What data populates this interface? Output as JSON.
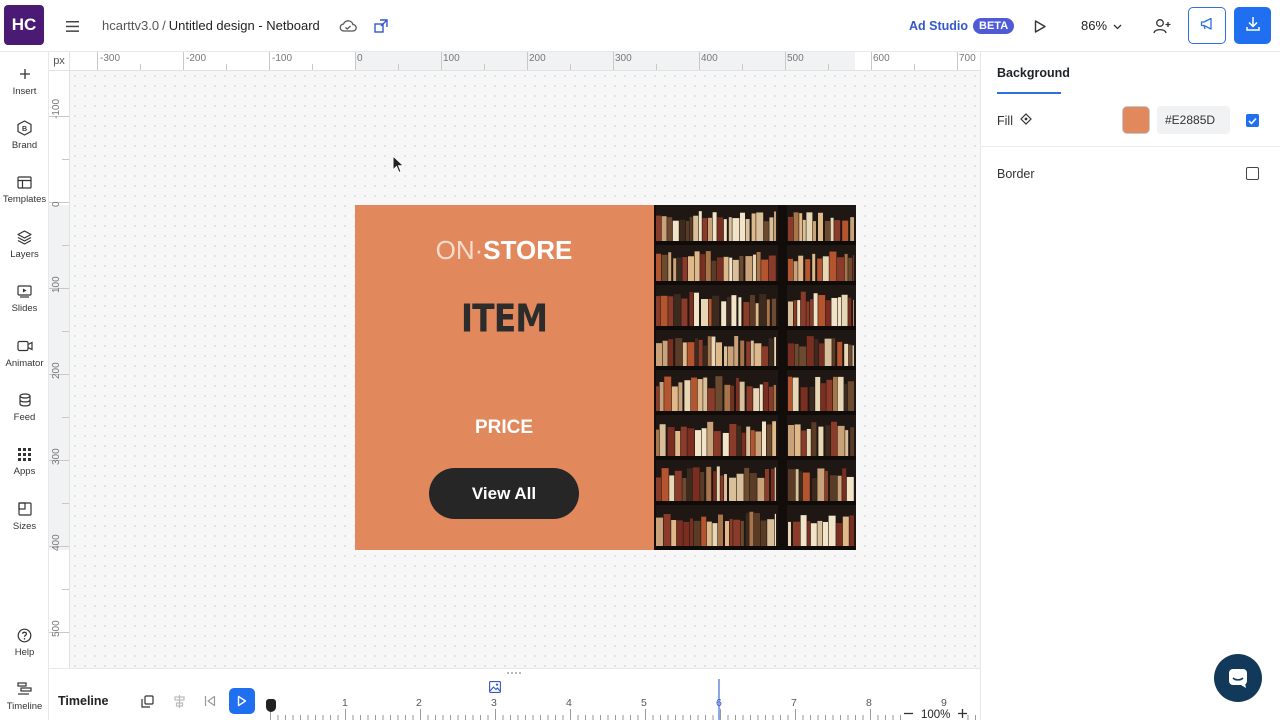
{
  "app": {
    "logo_text": "HC"
  },
  "header": {
    "workspace": "hcarttv3.0",
    "separator": "/",
    "design_title": "Untitled design - Netboard",
    "ad_studio_label": "Ad Studio",
    "beta_badge": "BETA",
    "zoom_level": "86%"
  },
  "sidebar": {
    "items": [
      {
        "label": "Insert",
        "icon": "plus-icon"
      },
      {
        "label": "Brand",
        "icon": "brand-icon"
      },
      {
        "label": "Templates",
        "icon": "templates-icon"
      },
      {
        "label": "Layers",
        "icon": "layers-icon"
      },
      {
        "label": "Slides",
        "icon": "slides-icon"
      },
      {
        "label": "Animator",
        "icon": "animator-icon"
      },
      {
        "label": "Feed",
        "icon": "database-icon"
      },
      {
        "label": "Apps",
        "icon": "grid-icon"
      },
      {
        "label": "Sizes",
        "icon": "sizes-icon"
      }
    ],
    "bottom_items": [
      {
        "label": "Help",
        "icon": "help-icon"
      },
      {
        "label": "Timeline",
        "icon": "timeline-icon"
      }
    ]
  },
  "ruler": {
    "unit": "px",
    "h_labels": [
      "-300",
      "-200",
      "-100",
      "0",
      "100",
      "200",
      "300",
      "400",
      "500",
      "600",
      "700"
    ],
    "v_labels": [
      "-100",
      "0",
      "100",
      "200",
      "300",
      "400",
      "500"
    ]
  },
  "artboard": {
    "background_color": "#E2885D",
    "brand_prefix": "ON",
    "brand_dot": "·",
    "brand_suffix": "STORE",
    "item_text": "ITEM",
    "price_text": "PRICE",
    "cta_label": "View All"
  },
  "properties": {
    "tab_label": "Background",
    "fill_label": "Fill",
    "fill_hex": "#E2885D",
    "fill_enabled": true,
    "border_label": "Border",
    "border_enabled": false
  },
  "timeline": {
    "title": "Timeline",
    "seconds": [
      "1",
      "2",
      "3",
      "4",
      "5",
      "6",
      "7",
      "8",
      "9"
    ],
    "zoom": "100%"
  }
}
